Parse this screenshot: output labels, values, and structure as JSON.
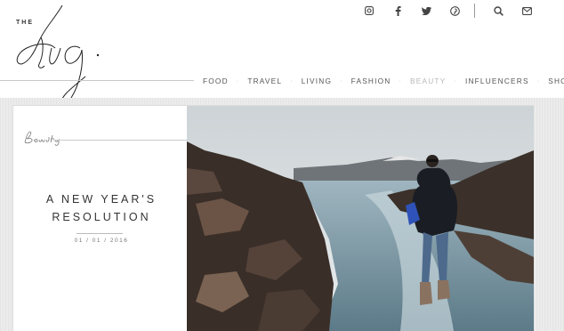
{
  "brand": {
    "prefix": "THE",
    "name": "tig."
  },
  "social": [
    {
      "name": "instagram"
    },
    {
      "name": "facebook"
    },
    {
      "name": "twitter"
    },
    {
      "name": "pinterest"
    }
  ],
  "utility": [
    {
      "name": "search"
    },
    {
      "name": "mail"
    }
  ],
  "nav": {
    "items": [
      "FOOD",
      "TRAVEL",
      "LIVING",
      "FASHION",
      "BEAUTY",
      "INFLUENCERS",
      "SHOP"
    ],
    "active": "BEAUTY"
  },
  "category_label": "Beauty",
  "post": {
    "title_line1": "A NEW YEAR'S",
    "title_line2": "RESOLUTION",
    "date": "01 / 01 / 2016"
  },
  "colors": {
    "nav_active": "#b7b7b7",
    "text": "#333333",
    "divider": "#cccccc"
  }
}
